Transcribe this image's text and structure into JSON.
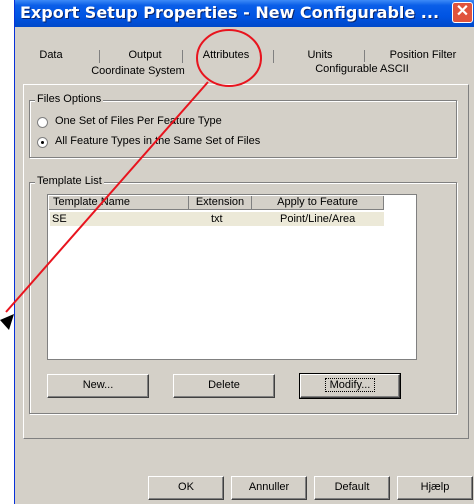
{
  "window": {
    "title": "Export Setup Properties - New Configurable ...",
    "close_glyph": "✕"
  },
  "tabs": {
    "row1": [
      "Data",
      "Output",
      "Attributes",
      "Units",
      "Position Filter"
    ],
    "row2": [
      "Coordinate System",
      "Configurable ASCII"
    ]
  },
  "files_options": {
    "title": "Files Options",
    "option1": "One Set of Files Per Feature Type",
    "option2": "All Feature Types in the Same Set of Files",
    "selected": 2
  },
  "template_list": {
    "title": "Template List",
    "columns": [
      "Template Name",
      "Extension",
      "Apply to Feature"
    ],
    "rows": [
      {
        "name": "SE",
        "extension": "txt",
        "apply": "Point/Line/Area"
      }
    ],
    "buttons": {
      "new": "New...",
      "delete": "Delete",
      "modify": "Modify..."
    }
  },
  "footer_buttons": {
    "ok": "OK",
    "cancel": "Annuller",
    "default": "Default",
    "help": "Hjælp"
  },
  "annotation": {
    "circle_color": "#e8141e",
    "arrow_color": "#000000"
  }
}
